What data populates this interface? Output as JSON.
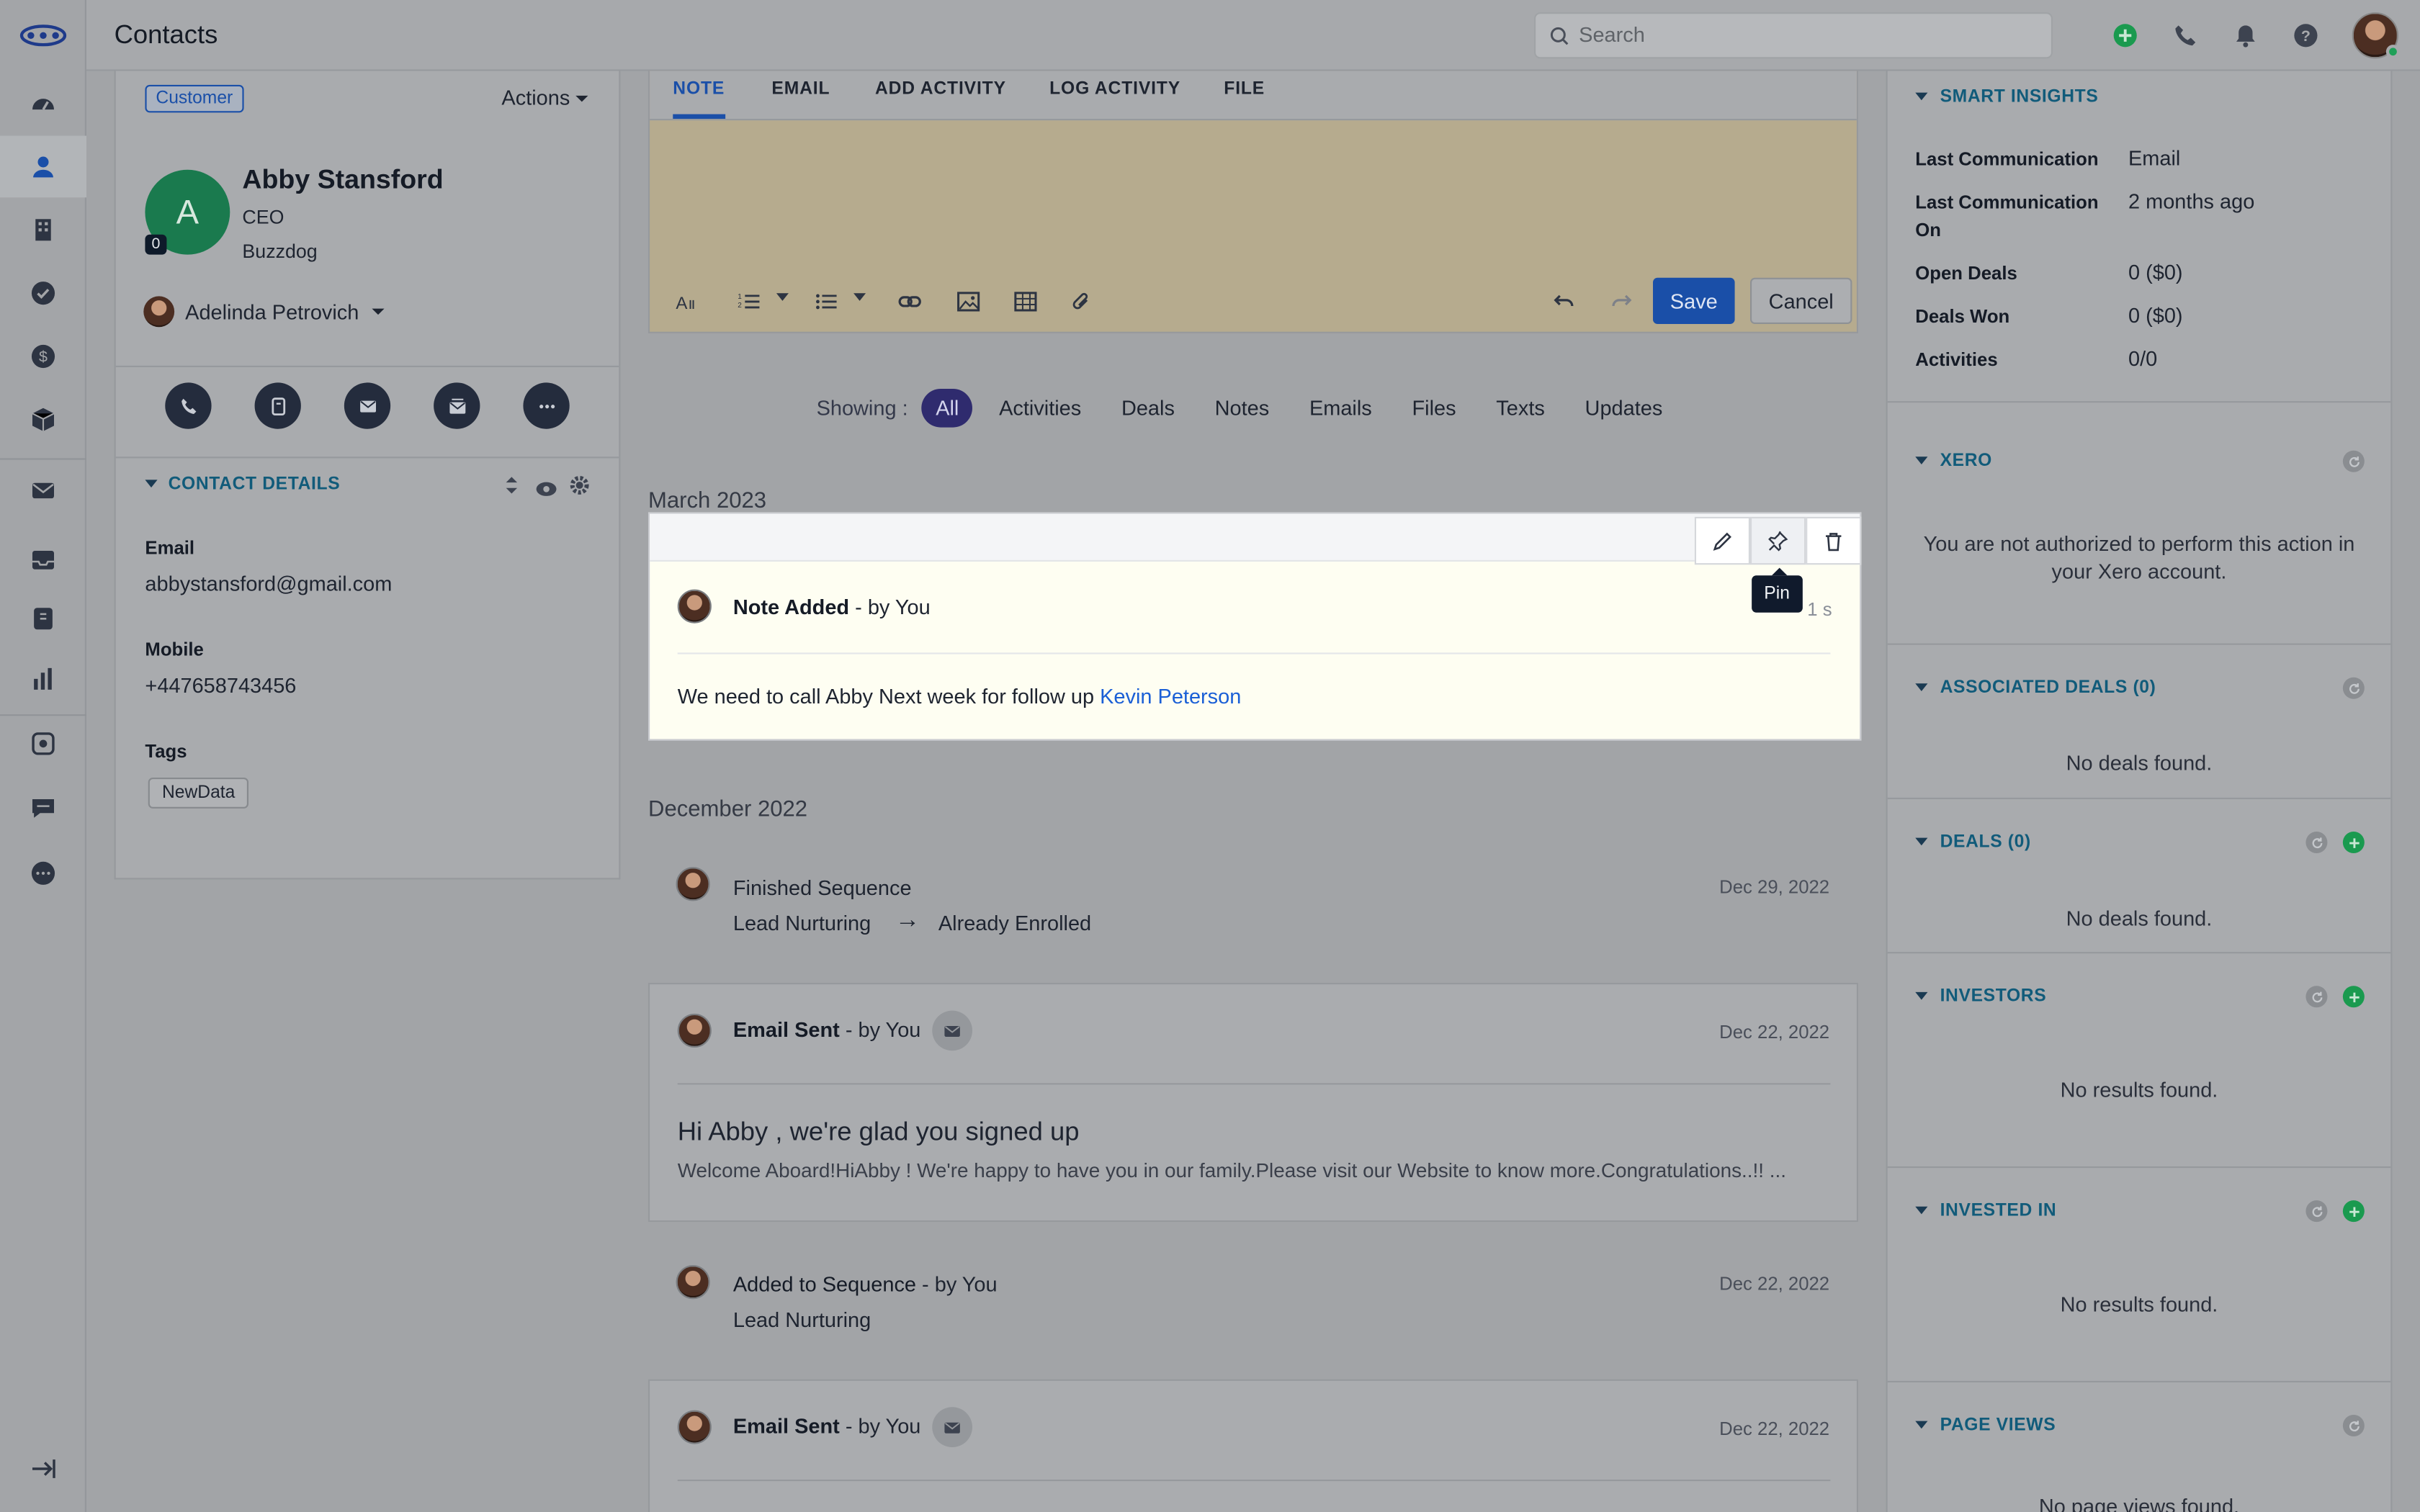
{
  "header": {
    "title": "Contacts",
    "search_placeholder": "Search"
  },
  "nav": {
    "items": [
      "dashboard",
      "contacts",
      "companies",
      "tasks",
      "deals",
      "products",
      "email",
      "inbox",
      "sequences",
      "reports",
      "integrations",
      "chat",
      "more"
    ]
  },
  "contact": {
    "badge": "Customer",
    "actions_label": "Actions",
    "avatar_letter": "A",
    "avatar_count": "0",
    "name": "Abby Stansford",
    "title": "CEO",
    "company": "Buzzdog",
    "owner": "Adelinda Petrovich",
    "details_header": "CONTACT DETAILS",
    "email_label": "Email",
    "email": "abbystansford@gmail.com",
    "mobile_label": "Mobile",
    "mobile": "+447658743456",
    "tags_label": "Tags",
    "tag": "NewData"
  },
  "composer": {
    "tabs": [
      "NOTE",
      "EMAIL",
      "ADD ACTIVITY",
      "LOG ACTIVITY",
      "FILE"
    ],
    "save": "Save",
    "cancel": "Cancel"
  },
  "filters": {
    "label": "Showing :",
    "items": [
      "All",
      "Activities",
      "Deals",
      "Notes",
      "Emails",
      "Files",
      "Texts",
      "Updates"
    ]
  },
  "timeline": {
    "month1": "March 2023",
    "note": {
      "title_bold": "Note Added",
      "title_rest": " - by You",
      "time": "1 s",
      "tooltip": "Pin",
      "body": "We need to call Abby Next week for follow up ",
      "mention": "Kevin Peterson"
    },
    "month2": "December 2022",
    "finished": {
      "title": "Finished Sequence",
      "date": "Dec 29, 2022",
      "from": "Lead Nurturing",
      "arrow": "→",
      "to": "Already Enrolled"
    },
    "email1": {
      "title_bold": "Email Sent",
      "title_rest": " - by You",
      "date": "Dec 22, 2022",
      "subject": "Hi Abby , we're glad you signed up",
      "preview": "Welcome Aboard!HiAbby ! We're happy to have you in our family.Please visit our Website to know more.Congratulations..!! ..."
    },
    "added": {
      "title_bold": "Added to Sequence",
      "title_rest": " - by You",
      "date": "Dec 22, 2022",
      "sub": "Lead Nurturing"
    },
    "email2": {
      "title_bold": "Email Sent",
      "title_rest": " - by You",
      "date": "Dec 22, 2022"
    }
  },
  "insights": {
    "header": "SMART INSIGHTS",
    "rows": [
      {
        "k": "Last Communication",
        "v": "Email"
      },
      {
        "k": "Last Communication On",
        "v": "2 months ago"
      },
      {
        "k": "Open Deals",
        "v": "0 ($0)"
      },
      {
        "k": "Deals Won",
        "v": "0 ($0)"
      },
      {
        "k": "Activities",
        "v": "0/0"
      }
    ]
  },
  "right_sections": {
    "xero": {
      "header": "XERO",
      "msg": "You are not authorized to perform this action in your Xero account."
    },
    "assoc": {
      "header": "ASSOCIATED DEALS (0)",
      "msg": "No deals found."
    },
    "deals": {
      "header": "DEALS (0)",
      "msg": "No deals found."
    },
    "investors": {
      "header": "INVESTORS",
      "msg": "No results found."
    },
    "invested": {
      "header": "INVESTED IN",
      "msg": "No results found."
    },
    "pageviews": {
      "header": "PAGE VIEWS",
      "msg": "No page views found."
    }
  },
  "colors": {
    "accent": "#1a4fa8",
    "green": "#1a9a4f",
    "section_header": "#115b7a",
    "filter_active": "#2f2b6e"
  }
}
